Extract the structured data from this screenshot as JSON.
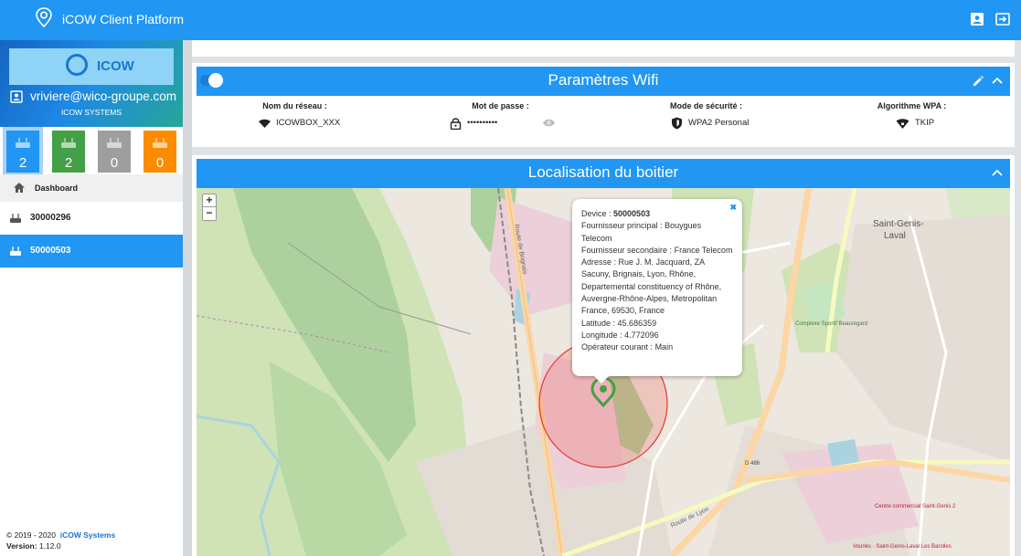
{
  "app": {
    "title": "iCOW Client Platform"
  },
  "sidebar": {
    "brand": "ICOW",
    "user_email": "vriviere@wico-groupe.com",
    "company": "ICOW SYSTEMS",
    "counters": [
      {
        "value": "2",
        "color": "#2196f3"
      },
      {
        "value": "2",
        "color": "#43a047"
      },
      {
        "value": "0",
        "color": "#9e9e9e"
      },
      {
        "value": "0",
        "color": "#fb8c00"
      }
    ],
    "dashboard_label": "Dashboard",
    "devices": [
      {
        "label": "30000296"
      },
      {
        "label": "50000503"
      }
    ],
    "footer": {
      "copyright": "© 2019 - 2020",
      "company_link": "iCOW Systems",
      "version_label": "Version:",
      "version": "1.12.0"
    }
  },
  "wifi": {
    "title": "Paramètres Wifi",
    "network_label": "Nom du réseau :",
    "network_value": "ICOWBOX_XXX",
    "password_label": "Mot de passe :",
    "password_value": "••••••••••",
    "security_label": "Mode de sécurité :",
    "security_value": "WPA2 Personal",
    "wpa_label": "Algorithme WPA :",
    "wpa_value": "TKIP"
  },
  "location": {
    "title": "Localisation du boitier",
    "zoom_in": "+",
    "zoom_out": "−",
    "popup": {
      "close": "✖",
      "device_label": "Device :",
      "device_value": "50000503",
      "primary_label": "Fournisseur principal :",
      "primary_value": "Bouygues Telecom",
      "secondary_label": "Fournisseur secondaire :",
      "secondary_value": "France Telecom",
      "address_label": "Adresse :",
      "address_value": "Rue J. M. Jacquard, ZA Sacuny, Brignais, Lyon, Rhône, Departemental constituency of Rhône, Auvergne-Rhône-Alpes, Metropolitan France, 69530, France",
      "lat_label": "Latitude :",
      "lat_value": "45.686359",
      "lon_label": "Longitude :",
      "lon_value": "4.772096",
      "op_label": "Opérateur courant :",
      "op_value": "Main"
    },
    "map_labels": {
      "saint_genis": "Saint-Genis-",
      "laval": "Laval",
      "route_brignais": "Route de Brignais",
      "route_lyon": "Route de Lyon",
      "complexe": "Complexe Sportif Beauregard",
      "d486": "D 486",
      "centre": "Centre commercial Saint-Genis 2",
      "bottom_right": "Vourles · Saint-Genis-Laval Les Barolles"
    }
  }
}
